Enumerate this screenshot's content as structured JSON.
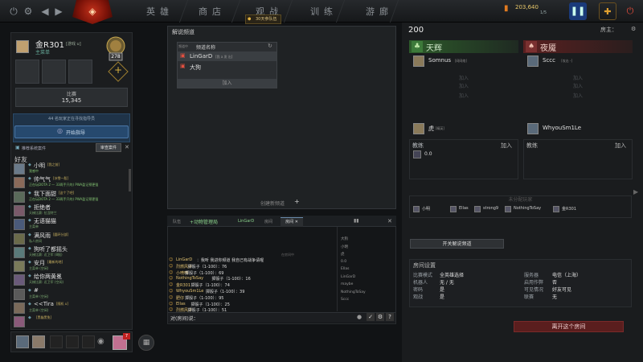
{
  "topbar": {
    "nav_items": [
      "英雄",
      "商店",
      "观战",
      "训练",
      "游廊"
    ],
    "queue_label": "30天参队伍",
    "gold": "203,640",
    "gold_sub": "1/5"
  },
  "profile": {
    "name": "金R301",
    "tag": "[游戏 u]",
    "status": "主菜单",
    "rank": "278",
    "score_label": "比赛",
    "score": "15,345",
    "coach_line": "44 名玩家正在寻找指导员",
    "coach_button": "开始指导",
    "recommend_label": "推荐系统案件",
    "review_button": "审查案件"
  },
  "friends": {
    "header": "好友",
    "items": [
      {
        "name": "小明",
        "tag": "[我之前]",
        "status": "我感中"
      },
      {
        "name": "帅气气",
        "tag": "[冰雪一股]",
        "status": "正在玩DOTA 2 — 33两手只的) PWA盈记预更强"
      },
      {
        "name": "我下面甜",
        "tag": "[这个了吧]",
        "status": "正在玩DOTA 2 — 33两手只的) PWA盈记预更强"
      },
      {
        "name": "拒绝者",
        "tag": "",
        "status": "天梯比赛: 拉涅特兰"
      },
      {
        "name": "无语猫猫",
        "tag": "",
        "status": "主菜单"
      },
      {
        "name": "满风雨",
        "tag": "[圆环分部]",
        "status": "私人房间"
      },
      {
        "name": "狗听了都摇头",
        "tag": "",
        "status": "天梯比赛: 近卫军 (8报)"
      },
      {
        "name": "安月",
        "tag": "[最新的地]",
        "status": "主菜单 (空闲)"
      },
      {
        "name": "给你两黄冕",
        "tag": "",
        "status": "天梯比赛: 近卫军 (空闲)"
      },
      {
        "name": "#",
        "tag": "",
        "status": "主菜单 (空闲)"
      },
      {
        "name": "<<Tira",
        "tag": "[随机 u]",
        "status": "主菜单 (空闲)"
      },
      {
        "name": "",
        "tag": "[黑貓黑兔]",
        "status": ""
      }
    ]
  },
  "center": {
    "title": "解说频道",
    "channel_col_label": "频道名称",
    "channel_col_prefix": "频道中",
    "channels": [
      {
        "name": "LinGarD",
        "tag": "[我 a 发 出]"
      },
      {
        "name": "大狗",
        "tag": ""
      }
    ],
    "join_label": "加入",
    "create_channel": "创建新频道"
  },
  "chat": {
    "tabs": [
      "队伍",
      "动物管理局",
      "LinGarD",
      "房间",
      "房间"
    ],
    "lines": [
      {
        "who": "LinGarD",
        "text": "：我听 我进你频道 我自己有战争请喔"
      },
      {
        "who": "烈燃风中",
        "text": "掷骰子（1-100）：76"
      },
      {
        "who": "小喷喷",
        "text": "掷骰子（1-100）：69"
      },
      {
        "who": "NothingToSay",
        "text": "掷骰子（1-100）：16"
      },
      {
        "who": "金R301",
        "text": "掷骰子（1-100）：74"
      },
      {
        "who": "WhyouSm1Le",
        "text": "掷骰子（1-100）：39"
      },
      {
        "who": "肥仔",
        "text": "掷骰子（1-100）：95"
      },
      {
        "who": "Ellas",
        "text": "掷骰子（1-100）：25"
      },
      {
        "who": "烈燃风中",
        "text": "掷骰子（1-100）：51"
      }
    ],
    "members_header": "在房间中",
    "members": [
      "大狗",
      "小明",
      "虎",
      "0.0",
      "Ellas",
      "LinGarD",
      "maybe",
      "NothingToSay",
      "Sccc"
    ],
    "input_prefix": "对(房间)说：",
    "help_icon": "?"
  },
  "lobby": {
    "number": "200",
    "host_label": "房主：",
    "radiant_label": "天辉",
    "dire_label": "夜魇",
    "radiant": [
      "Somnus",
      "加入",
      "加入",
      "加入",
      "虎"
    ],
    "radiant_tags": [
      "[网网络]",
      "",
      "",
      "",
      "[精英]"
    ],
    "dire": [
      "Sccc",
      "加入",
      "加入",
      "加入",
      "WhyouSm1Le"
    ],
    "dire_tags": [
      "[攻击 -]",
      "",
      "",
      "",
      ""
    ],
    "coach_label": "教练",
    "coach_join": "加入",
    "radiant_coach": "0.0",
    "unassigned_label": "未分配玩家",
    "unassigned": [
      "小明",
      "Ellas",
      "strong9",
      "NothingToSay",
      "金R301"
    ],
    "caster_button": "开关解说频道",
    "settings_title": "房间设置",
    "settings_left": [
      {
        "k": "比赛模式",
        "v": "全英雄选择"
      },
      {
        "k": "机器人",
        "v": "无 / 无"
      },
      {
        "k": "密码",
        "v": "是"
      },
      {
        "k": "观战",
        "v": "是"
      }
    ],
    "settings_right": [
      {
        "k": "服务器",
        "v": "电信（上海）"
      },
      {
        "k": "启用作弊",
        "v": "否"
      },
      {
        "k": "可见情况",
        "v": "好友可见"
      },
      {
        "k": "联赛",
        "v": "无"
      }
    ],
    "leave_button": "离开这个房间"
  },
  "bottom": {
    "notif_count": "7"
  }
}
